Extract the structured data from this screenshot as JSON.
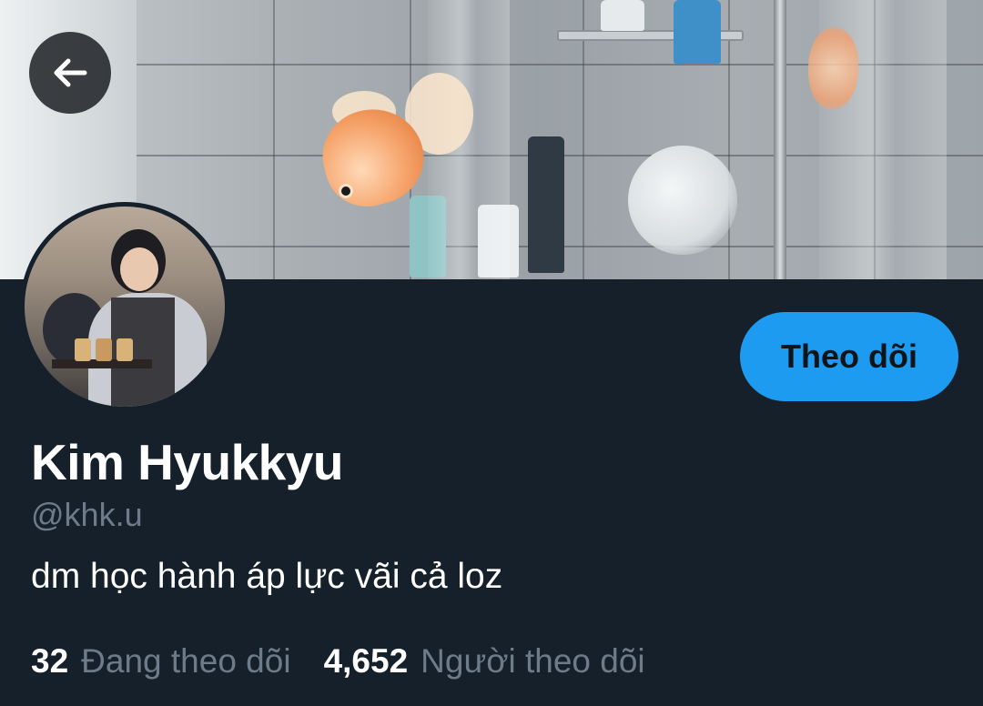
{
  "profile": {
    "display_name": "Kim Hyukkyu",
    "handle": "@khk.u",
    "bio": "dm học hành áp lực vãi cả loz"
  },
  "actions": {
    "follow_label": "Theo dõi"
  },
  "stats": {
    "following_count": "32",
    "following_label": "Đang theo dõi",
    "followers_count": "4,652",
    "followers_label": "Người theo dõi"
  },
  "icons": {
    "back": "arrow-left-icon"
  },
  "colors": {
    "background": "#15202b",
    "accent": "#1d9bf0",
    "muted_text": "#6e7c89",
    "text": "#ffffff"
  }
}
